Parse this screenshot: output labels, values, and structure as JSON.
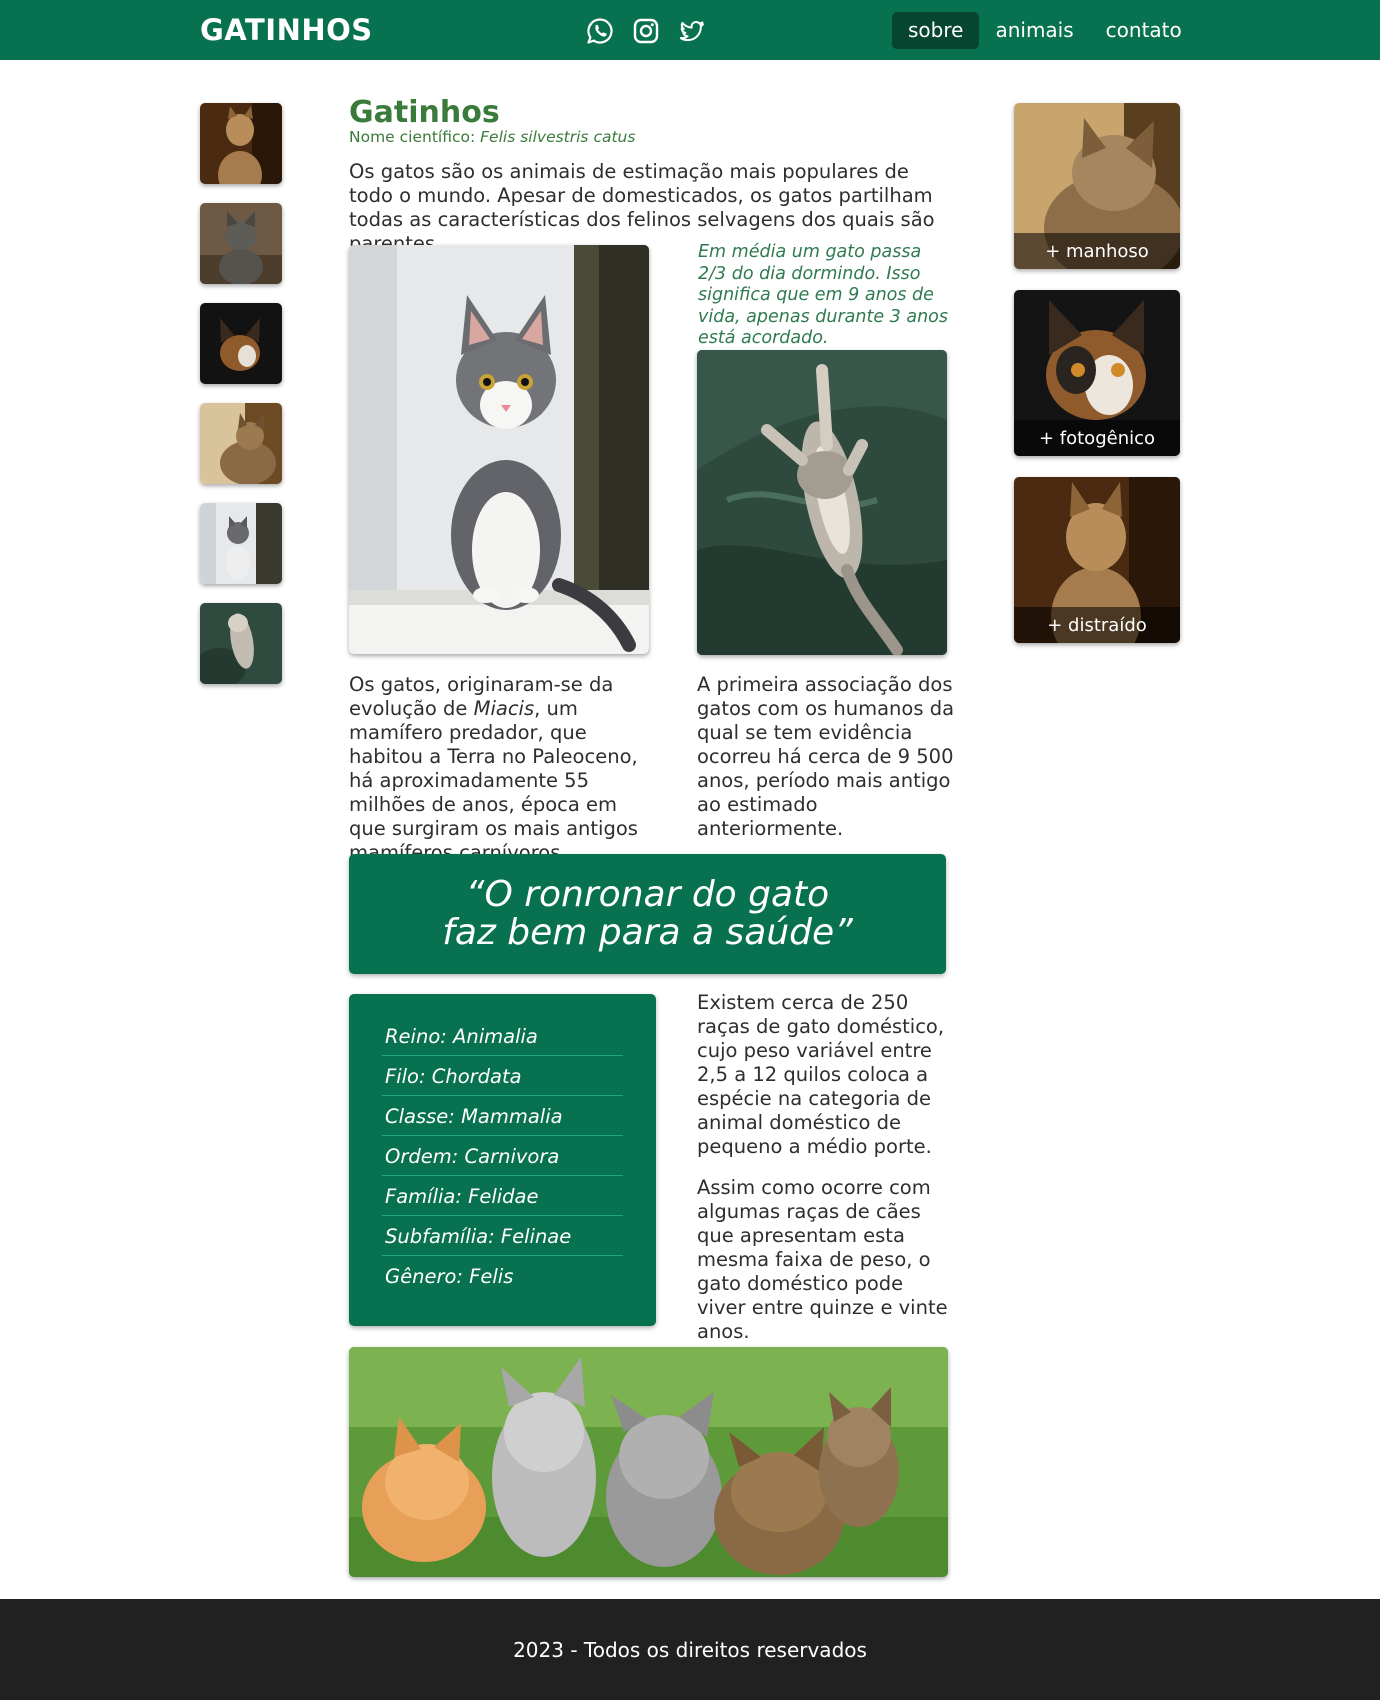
{
  "header": {
    "brand": "GATINHOS",
    "social": [
      "whatsapp-icon",
      "instagram-icon",
      "twitter-icon"
    ],
    "nav": [
      {
        "label": "sobre",
        "active": true
      },
      {
        "label": "animais",
        "active": false
      },
      {
        "label": "contato",
        "active": false
      }
    ]
  },
  "main": {
    "title": "Gatinhos",
    "scientific_prefix": "Nome científico:",
    "scientific_name": "Felis silvestris catus",
    "intro": "Os gatos são os animais de estimação mais populares de todo o mundo. Apesar de domesticados, os gatos partilham todas as características dos felinos selvagens dos quais são parentes.",
    "fact": "Em média um gato passa 2/3 do dia dormindo. Isso significa que em 9 anos de vida, apenas durante 3 anos está acordado.",
    "origin_before": "Os gatos, originaram-se da evolução de ",
    "origin_term": "Miacis",
    "origin_after": ", um mamífero predador, que habitou a Terra no Paleoceno, há aproximadamente 55 milhões de anos, época em que surgiram os mais antigos mamíferos carnívoros.",
    "association": "A primeira associação dos gatos com os humanos da qual se tem evidência ocorreu há cerca de 9 500 anos, período mais antigo ao estimado anteriormente.",
    "quote": "“O ronronar do gato faz bem para a saúde”",
    "breeds": "Existem cerca de 250 raças de gato doméstico, cujo peso variável entre 2,5 a 12 quilos coloca a espécie na categoria de animal doméstico de pequeno a médio porte.",
    "lifespan": "Assim como ocorre com algumas raças de cães que apresentam esta mesma faixa de peso, o gato doméstico pode viver entre quinze e vinte anos.",
    "taxonomy": [
      "Reino:  Animalia",
      "Filo: Chordata",
      "Classe: Mammalia",
      "Ordem: Carnivora",
      "Família: Felidae",
      "Subfamília: Felinae",
      "Gênero:  Felis"
    ]
  },
  "cards": [
    "+ manhoso",
    "+ fotogênico",
    "+ distraído"
  ],
  "footer": "2023 - Todos os direitos reservados",
  "colors": {
    "primary": "#087150",
    "nav_active": "#06452f",
    "title": "#3a7a3a",
    "fact": "#2f7a50",
    "footer": "#212121"
  }
}
